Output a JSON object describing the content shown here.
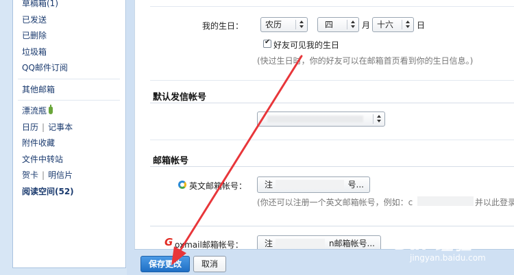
{
  "sidebar": {
    "items": [
      {
        "label": "草稿箱(1)"
      },
      {
        "label": "已发送"
      },
      {
        "label": "已删除"
      },
      {
        "label": "垃圾箱"
      },
      {
        "label": "QQ邮件订阅"
      },
      {
        "label": "其他邮箱"
      },
      {
        "label": "漂流瓶"
      },
      {
        "label_a": "日历",
        "sep": "|",
        "label_b": "记事本"
      },
      {
        "label": "附件收藏"
      },
      {
        "label": "文件中转站"
      },
      {
        "label_a": "贺卡",
        "sep": "|",
        "label_b": "明信片"
      },
      {
        "label": "阅读空间(52)"
      }
    ]
  },
  "birthday": {
    "label": "我的生日：",
    "calendar_value": "农历",
    "month_value": "四",
    "month_unit": "月",
    "day_value": "十六",
    "day_unit": "日",
    "friends_visible_label": "好友可见我的生日",
    "friends_visible_checked": true,
    "hint": "(快过生日时，你的好友可以在邮箱首页看到你的生日信息。)"
  },
  "default_sender": {
    "title": "默认发信帐号"
  },
  "mail_accounts": {
    "title": "邮箱帐号",
    "english_label": "英文邮箱帐号：",
    "english_button": "注",
    "english_button_tail": "号...",
    "english_hint_a": "(你还可以注册一个英文邮箱帐号，例如：c",
    "english_hint_b": "并以此登录",
    "foxmail_label": "oxmail邮箱帐号：",
    "foxmail_button": "注",
    "foxmail_button_tail": "n邮箱帐号..."
  },
  "footer": {
    "save_label": "保存更改",
    "cancel_label": "取消"
  },
  "watermark": {
    "text": "Bai  经验",
    "sub": "jingyan.baidu.com"
  },
  "colors": {
    "annotation_arrow": "#e8363a",
    "primary_button": "#2a7fd4"
  }
}
